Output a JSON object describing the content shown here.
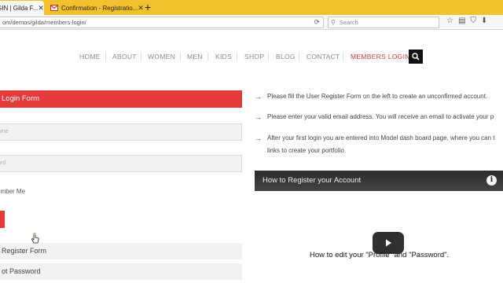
{
  "browser": {
    "tabs": [
      {
        "label": "GIN | Gilda F...",
        "active": true
      },
      {
        "label": "Confirmation - Registratio...",
        "active": false
      }
    ],
    "url": "om/demos/gilda/members-login/",
    "search_placeholder": "Search"
  },
  "nav": {
    "items": [
      "HOME",
      "ABOUT",
      "WOMEN",
      "MEN",
      "KIDS",
      "SHOP",
      "BLOG",
      "CONTACT",
      "MEMBERS LOGIN"
    ],
    "active": "MEMBERS LOGIN",
    "accent": "#d33b3b"
  },
  "login": {
    "title": "Login Form",
    "username_placeholder": "ame",
    "password_placeholder": "ord",
    "remember_label": "ember Me",
    "register_link": "Register Form",
    "forgot_link": "ot Password"
  },
  "instructions": [
    "Please fill the User Register Form on the left to create an unconfirmed account.",
    "Please enter your valid email address. You will receive an email to activate your p",
    "After your first login you are entered into Model dash board page, where you can t",
    "links to create your portfolio."
  ],
  "video": {
    "title": "How to Register your Account",
    "caption": "How to edit your \"Profile\" and \"Password\"."
  },
  "colors": {
    "brand_red": "#e53a3a",
    "tab_bar": "#f2c12e"
  }
}
